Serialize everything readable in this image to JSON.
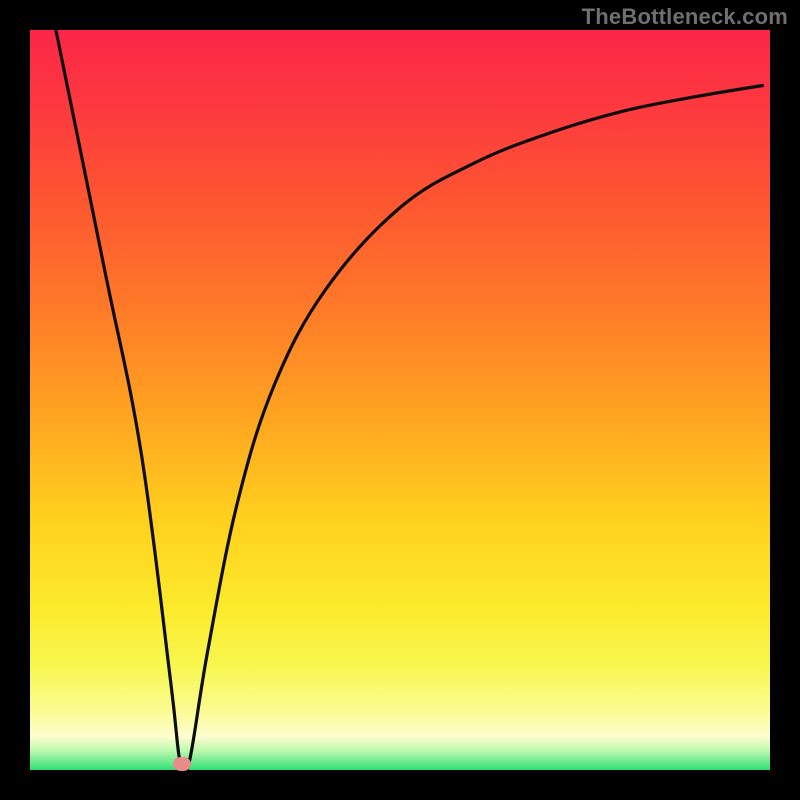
{
  "watermark": {
    "text": "TheBottleneck.com"
  },
  "colors": {
    "frame_border": "#000000",
    "curve_stroke": "#0d0d0d",
    "marker_fill": "#e98b89",
    "gradient_top": "#fc2647",
    "gradient_bottom": "#2fe07a"
  },
  "chart_data": {
    "type": "line",
    "title": "",
    "xlabel": "",
    "ylabel": "",
    "xlim": [
      0,
      100
    ],
    "ylim": [
      0,
      100
    ],
    "grid": false,
    "legend": false,
    "series": [
      {
        "name": "curve",
        "x": [
          3.5,
          10,
          15,
          19,
          20.3,
          21.5,
          24,
          28,
          33,
          40,
          50,
          60,
          70,
          80,
          90,
          99
        ],
        "y": [
          100,
          68,
          43,
          12,
          1,
          1,
          16,
          36,
          52,
          65,
          76,
          82,
          86,
          89,
          91,
          92.5
        ]
      }
    ],
    "marker": {
      "x": 20.6,
      "y": 0.8
    }
  }
}
